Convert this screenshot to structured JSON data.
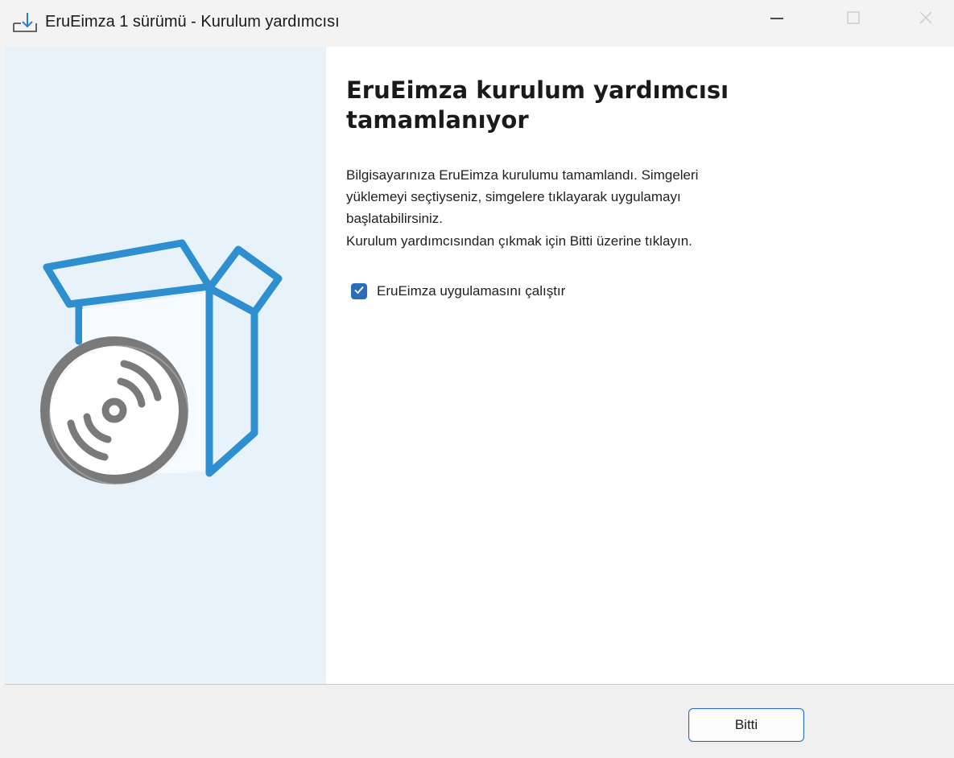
{
  "window": {
    "title": "EruEimza 1 sürümü - Kurulum yardımcısı",
    "icons": {
      "app": "download-tray-icon",
      "minimize": "minimize-icon",
      "maximize": "maximize-icon",
      "close": "close-icon"
    }
  },
  "sidebar": {
    "image": "installer-box-with-disc-icon"
  },
  "main": {
    "heading": "EruEimza kurulum yardımcısı tamamlanıyor",
    "paragraph1": "Bilgisayarınıza EruEimza kurulumu tamamlandı. Simgeleri yüklemeyi seçtiyseniz, simgelere tıklayarak uygulamayı başlatabilirsiniz.",
    "paragraph2": "Kurulum yardımcısından çıkmak için Bitti üzerine tıklayın.",
    "run_checkbox": {
      "label": "EruEimza uygulamasını çalıştır",
      "checked": true
    }
  },
  "footer": {
    "finish_label": "Bitti"
  },
  "colors": {
    "accent": "#2a6ebb",
    "sidebar_bg": "#e8f2fa",
    "box_blue": "#2e8fd0",
    "disc_gray": "#7a7a7a"
  }
}
